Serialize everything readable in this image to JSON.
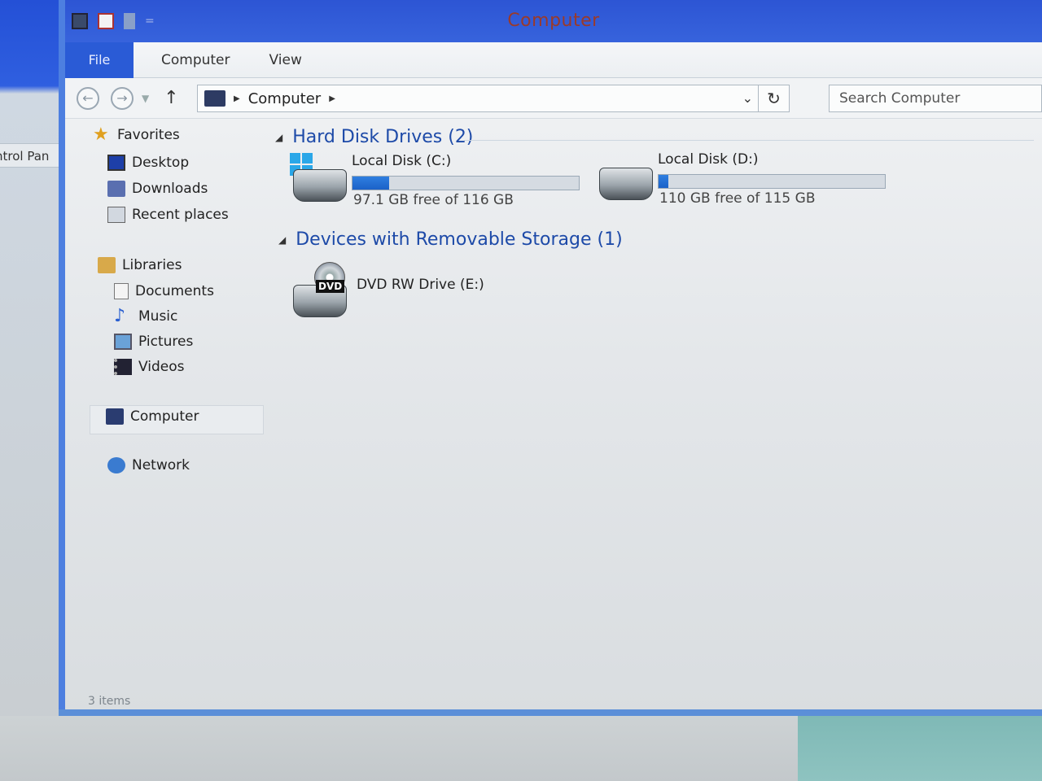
{
  "window": {
    "title": "Computer"
  },
  "background": {
    "partial_window_text": "ntrol Pan"
  },
  "ribbon": {
    "tabs": [
      {
        "label": "File"
      },
      {
        "label": "Computer"
      },
      {
        "label": "View"
      }
    ]
  },
  "address": {
    "location": "Computer"
  },
  "search": {
    "placeholder": "Search Computer"
  },
  "navpane": {
    "favorites": {
      "label": "Favorites",
      "items": [
        {
          "label": "Desktop"
        },
        {
          "label": "Downloads"
        },
        {
          "label": "Recent places"
        }
      ]
    },
    "libraries": {
      "label": "Libraries",
      "items": [
        {
          "label": "Documents"
        },
        {
          "label": "Music"
        },
        {
          "label": "Pictures"
        },
        {
          "label": "Videos"
        }
      ]
    },
    "computer": {
      "label": "Computer"
    },
    "network": {
      "label": "Network"
    }
  },
  "content": {
    "hdd_section": "Hard Disk Drives (2)",
    "removable_section": "Devices with Removable Storage (1)",
    "drives": [
      {
        "name": "Local Disk (C:)",
        "free_text": "97.1 GB free of 116 GB",
        "used_fraction": 0.163
      },
      {
        "name": "Local Disk (D:)",
        "free_text": "110 GB free of 115 GB",
        "used_fraction": 0.043
      }
    ],
    "dvd": {
      "name": "DVD RW Drive (E:)",
      "label": "DVD"
    }
  },
  "status": {
    "items": "3 items"
  }
}
